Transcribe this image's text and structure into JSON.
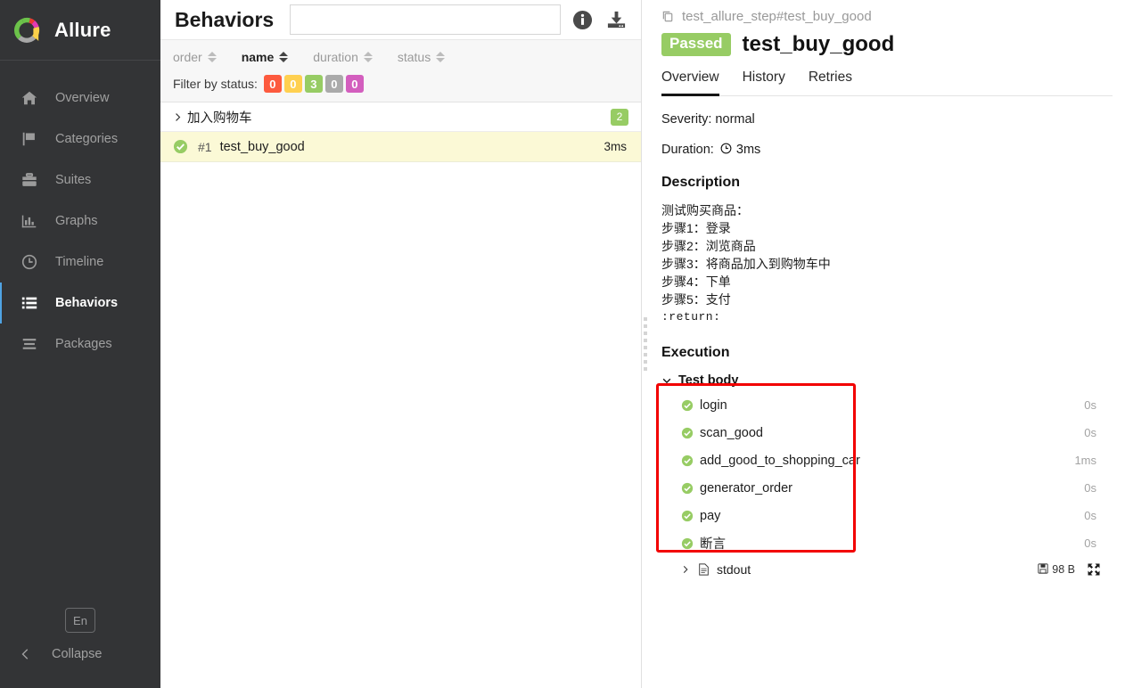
{
  "sidebar": {
    "brand": "Allure",
    "logo_icon": "allure-logo",
    "items": [
      {
        "label": "Overview",
        "icon": "home-icon",
        "active": false
      },
      {
        "label": "Categories",
        "icon": "flag-icon",
        "active": false
      },
      {
        "label": "Suites",
        "icon": "briefcase-icon",
        "active": false
      },
      {
        "label": "Graphs",
        "icon": "bar-chart-icon",
        "active": false
      },
      {
        "label": "Timeline",
        "icon": "clock-icon",
        "active": false
      },
      {
        "label": "Behaviors",
        "icon": "list-icon",
        "active": true
      },
      {
        "label": "Packages",
        "icon": "layers-icon",
        "active": false
      }
    ],
    "language": "En",
    "collapse_label": "Collapse",
    "collapse_icon": "chevron-left-icon",
    "accent_color": "#4fa3e3"
  },
  "middle": {
    "title": "Behaviors",
    "search_value": "",
    "search_placeholder": "",
    "info_icon": "info-icon",
    "download_icon": "download-icon",
    "sort": [
      {
        "label": "order",
        "active": false
      },
      {
        "label": "name",
        "active": true
      },
      {
        "label": "duration",
        "active": false
      },
      {
        "label": "status",
        "active": false
      }
    ],
    "filter_label": "Filter by status:",
    "status_badges": [
      {
        "value": "0",
        "color": "#fd5a3e",
        "status": "failed"
      },
      {
        "value": "0",
        "color": "#ffd050",
        "status": "broken"
      },
      {
        "value": "3",
        "color": "#97cc64",
        "status": "passed"
      },
      {
        "value": "0",
        "color": "#aaaaaa",
        "status": "skipped"
      },
      {
        "value": "0",
        "color": "#d35ebe",
        "status": "unknown"
      }
    ],
    "tree": [
      {
        "type": "group",
        "label": "加入购物车",
        "badge": "2",
        "badge_color": "#97cc64",
        "chevron": "chevron-right-icon"
      }
    ],
    "leaf": {
      "order": "#1",
      "name": "test_buy_good",
      "duration": "3ms",
      "status": "passed",
      "status_icon": "check-circle-icon"
    }
  },
  "detail": {
    "breadcrumb": "test_allure_step#test_buy_good",
    "breadcrumb_icon": "copy-icon",
    "status_chip": "Passed",
    "status_chip_color": "#97cc64",
    "title": "test_buy_good",
    "tabs": [
      {
        "label": "Overview",
        "active": true
      },
      {
        "label": "History",
        "active": false
      },
      {
        "label": "Retries",
        "active": false
      }
    ],
    "severity_line": "Severity: normal",
    "duration_label": "Duration:",
    "duration_value": "3ms",
    "duration_icon": "clock-icon",
    "description_heading": "Description",
    "description_lines": [
      "测试购买商品：",
      "步骤1：登录",
      "步骤2：浏览商品",
      "步骤3：将商品加入到购物车中",
      "步骤4：下单",
      "步骤5：支付"
    ],
    "description_return": ":return:",
    "execution_heading": "Execution",
    "test_body_label": "Test body",
    "test_body_chevron": "chevron-down-icon",
    "steps": [
      {
        "name": "login",
        "duration": "0s",
        "status": "passed"
      },
      {
        "name": "scan_good",
        "duration": "0s",
        "status": "passed"
      },
      {
        "name": "add_good_to_shopping_car",
        "duration": "1ms",
        "status": "passed"
      },
      {
        "name": "generator_order",
        "duration": "0s",
        "status": "passed"
      },
      {
        "name": "pay",
        "duration": "0s",
        "status": "passed"
      },
      {
        "name": "断言",
        "duration": "0s",
        "status": "passed"
      }
    ],
    "attachment": {
      "name": "stdout",
      "size": "98 B",
      "chevron": "chevron-right-icon",
      "file_icon": "file-icon",
      "save_icon": "floppy-icon",
      "expand_icon": "expand-icon"
    }
  },
  "annotation": {
    "color": "#f20000",
    "shape": "rectangle"
  }
}
